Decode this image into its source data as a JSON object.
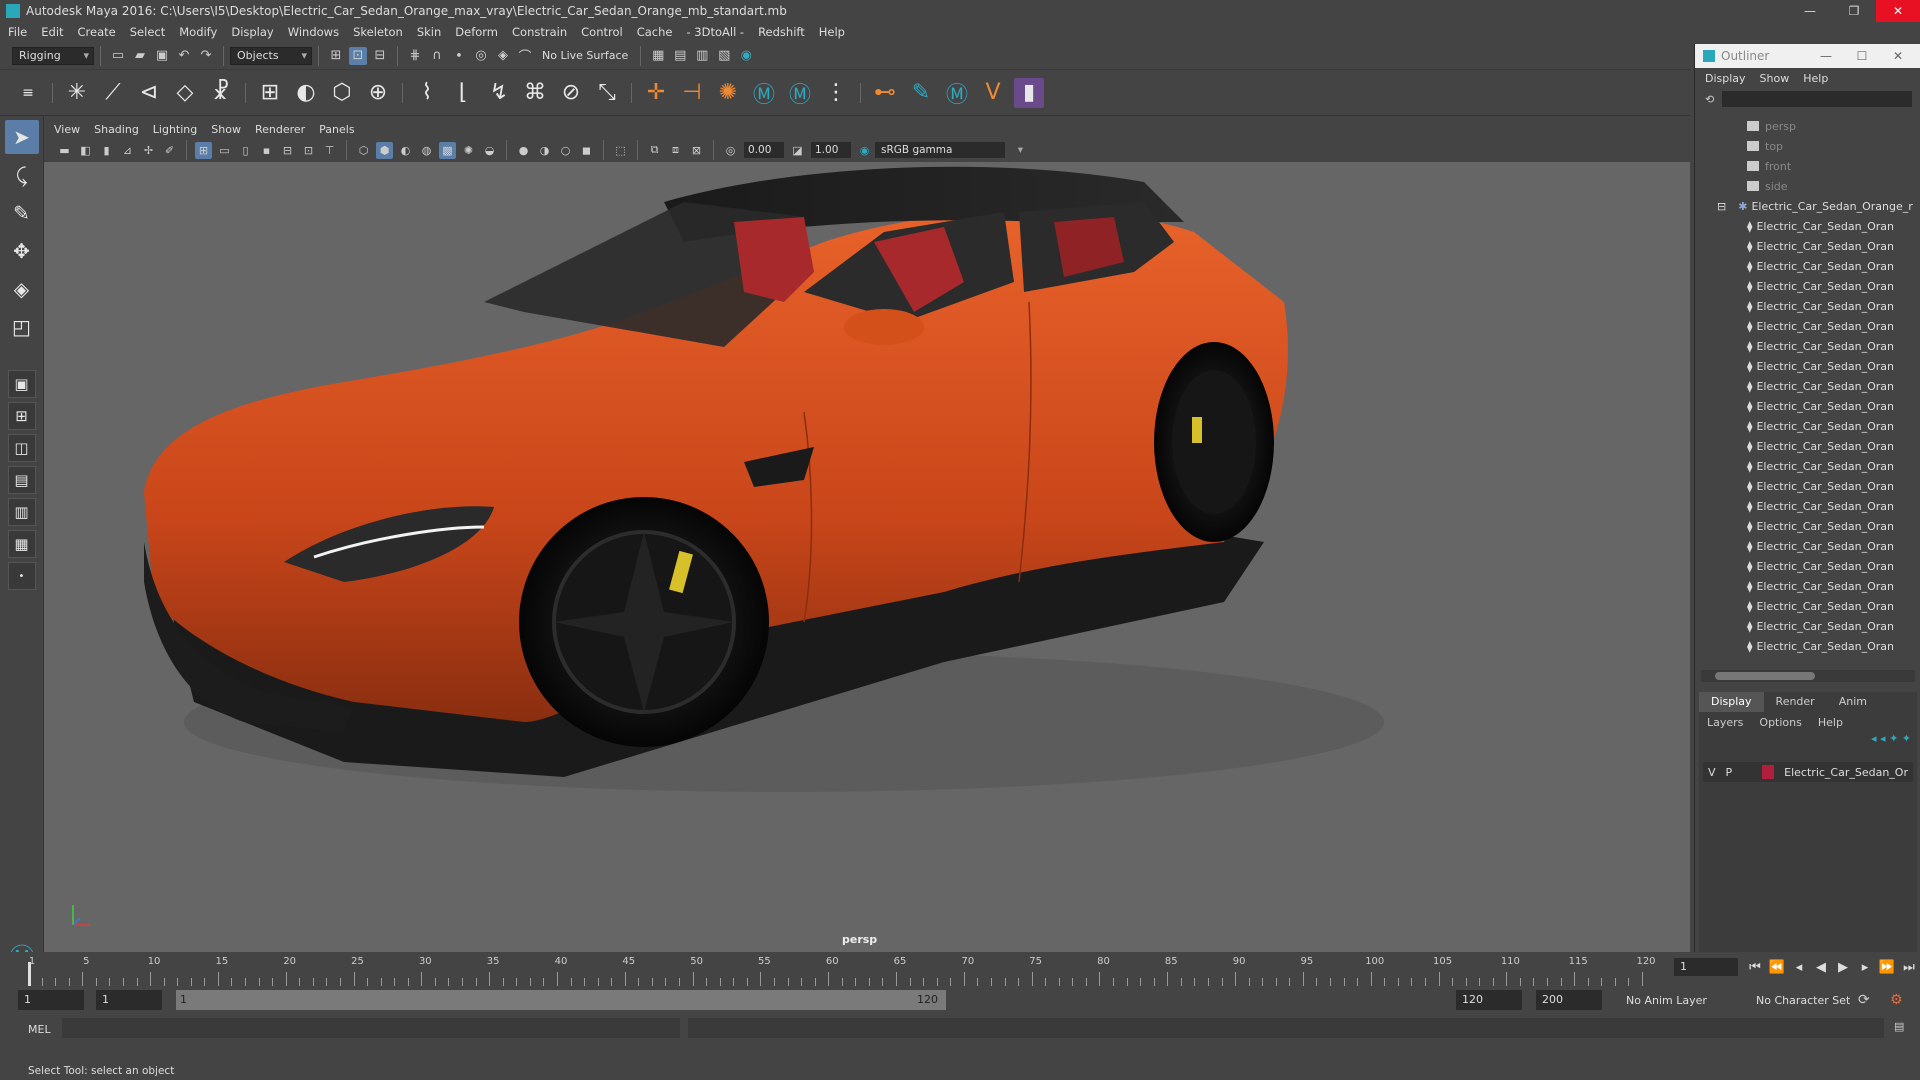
{
  "window": {
    "title": "Autodesk Maya 2016: C:\\Users\\I5\\Desktop\\Electric_Car_Sedan_Orange_max_vray\\Electric_Car_Sedan_Orange_mb_standart.mb",
    "minimize": "—",
    "maximize": "❐",
    "close": "✕"
  },
  "menubar": [
    "File",
    "Edit",
    "Create",
    "Select",
    "Modify",
    "Display",
    "Windows",
    "Skeleton",
    "Skin",
    "Deform",
    "Constrain",
    "Control",
    "Cache",
    "- 3DtoAll -",
    "Redshift",
    "Help"
  ],
  "statusline": {
    "mode": "Rigging",
    "selection_mask": "Objects",
    "live_surface": "No Live Surface"
  },
  "viewport": {
    "menus": [
      "View",
      "Shading",
      "Lighting",
      "Show",
      "Renderer",
      "Panels"
    ],
    "exposure": "0.00",
    "gamma_value": "1.00",
    "color_space": "sRGB gamma",
    "camera_label": "persp"
  },
  "outliner": {
    "title": "Outliner",
    "menus": [
      "Display",
      "Show",
      "Help"
    ],
    "cameras": [
      "persp",
      "top",
      "front",
      "side"
    ],
    "group": "Electric_Car_Sedan_Orange_r",
    "children": [
      "Electric_Car_Sedan_Oran",
      "Electric_Car_Sedan_Oran",
      "Electric_Car_Sedan_Oran",
      "Electric_Car_Sedan_Oran",
      "Electric_Car_Sedan_Oran",
      "Electric_Car_Sedan_Oran",
      "Electric_Car_Sedan_Oran",
      "Electric_Car_Sedan_Oran",
      "Electric_Car_Sedan_Oran",
      "Electric_Car_Sedan_Oran",
      "Electric_Car_Sedan_Oran",
      "Electric_Car_Sedan_Oran",
      "Electric_Car_Sedan_Oran",
      "Electric_Car_Sedan_Oran",
      "Electric_Car_Sedan_Oran",
      "Electric_Car_Sedan_Oran",
      "Electric_Car_Sedan_Oran",
      "Electric_Car_Sedan_Oran",
      "Electric_Car_Sedan_Oran",
      "Electric_Car_Sedan_Oran",
      "Electric_Car_Sedan_Oran",
      "Electric_Car_Sedan_Oran"
    ]
  },
  "layers": {
    "tabs": [
      "Display",
      "Render",
      "Anim"
    ],
    "active_tab": "Display",
    "menus": [
      "Layers",
      "Options",
      "Help"
    ],
    "row": {
      "v": "V",
      "p": "P",
      "name": "Electric_Car_Sedan_Or",
      "color": "#b01f3b"
    }
  },
  "timeline": {
    "labels": [
      "1",
      "5",
      "10",
      "15",
      "20",
      "25",
      "30",
      "35",
      "40",
      "45",
      "50",
      "55",
      "60",
      "65",
      "70",
      "75",
      "80",
      "85",
      "90",
      "95",
      "100",
      "105",
      "110",
      "115",
      "120"
    ],
    "current_frame": "1"
  },
  "range": {
    "start_field": "1",
    "playback_start": "1",
    "slider_start": "1",
    "slider_end": "120",
    "playback_end": "120",
    "end_field": "200",
    "anim_layer": "No Anim Layer",
    "character_set": "No Character Set"
  },
  "command": {
    "label": "MEL"
  },
  "helpline": "Select Tool: select an object",
  "colors": {
    "car_body": "#d4501a",
    "interior": "#a8292c",
    "viewport_bg": "#666666",
    "accent": "#5a7ea8"
  }
}
